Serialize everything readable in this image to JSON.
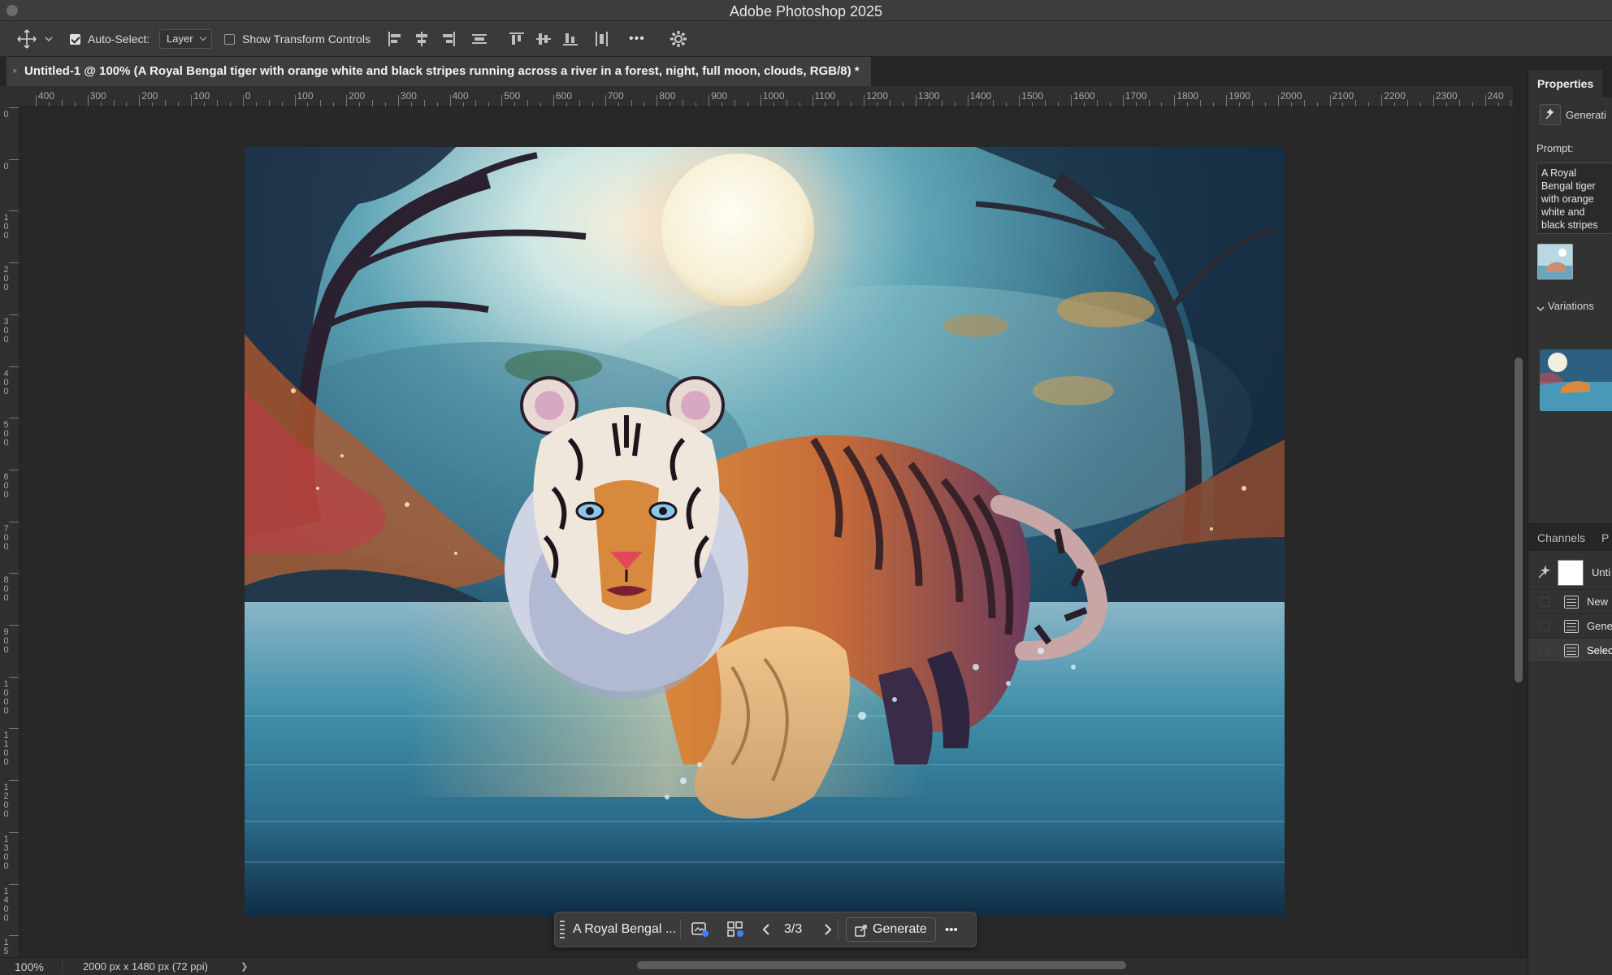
{
  "app": {
    "title": "Adobe Photoshop 2025"
  },
  "options_bar": {
    "auto_select_label": "Auto-Select:",
    "auto_select_checked": true,
    "auto_select_target": "Layer",
    "show_transform_label": "Show Transform Controls",
    "show_transform_checked": false,
    "more_label": "•••"
  },
  "document": {
    "tab_title": "Untitled-1 @ 100% (A Royal Bengal tiger with orange white and black stripes running across a river in a forest, night, full moon, clouds, RGB/8) *",
    "close_glyph": "×"
  },
  "ruler": {
    "h_labels": [
      "400",
      "300",
      "200",
      "100",
      "0",
      "100",
      "200",
      "300",
      "400",
      "500",
      "600",
      "700",
      "800",
      "900",
      "1000",
      "1100",
      "1200",
      "1300",
      "1400",
      "1500",
      "1600",
      "1700",
      "1800",
      "1900",
      "2000",
      "2100",
      "2200",
      "2300",
      "240"
    ],
    "v_labels": [
      "0",
      "0",
      "1 0 0",
      "2 0 0",
      "3 0 0",
      "4 0 0",
      "5 0 0",
      "6 0 0",
      "7 0 0",
      "8 0 0",
      "9 0 0",
      "1 0 0 0",
      "1 1 0 0",
      "1 2 0 0",
      "1 3 0 0",
      "1 4 0 0",
      "1 5"
    ]
  },
  "taskbar": {
    "prompt_excerpt": "A Royal Bengal ...",
    "variation_counter": "3/3",
    "generate_label": "Generate",
    "more_label": "•••"
  },
  "status": {
    "zoom": "100%",
    "doc_size": "2000 px x 1480 px (72 ppi)",
    "arrow": "❯"
  },
  "properties_panel": {
    "tabs": [
      "Properties"
    ],
    "gen_layer_label": "Generati",
    "prompt_label": "Prompt:",
    "prompt_text": "A Royal Bengal tiger with orange white and black stripes running across a river in a forest, night, full moon, clouds",
    "variations_label": "Variations"
  },
  "layers_panel": {
    "tabs": [
      "Channels",
      "P"
    ],
    "layers": [
      {
        "name": "Unti"
      },
      {
        "name": "New"
      },
      {
        "name": "Gene"
      },
      {
        "name": "Selec"
      }
    ]
  },
  "colors": {
    "bg": "#2b2b2b",
    "panel": "#323232",
    "accent_moon": "#fffbe8",
    "tiger_orange": "#d98a3a"
  }
}
